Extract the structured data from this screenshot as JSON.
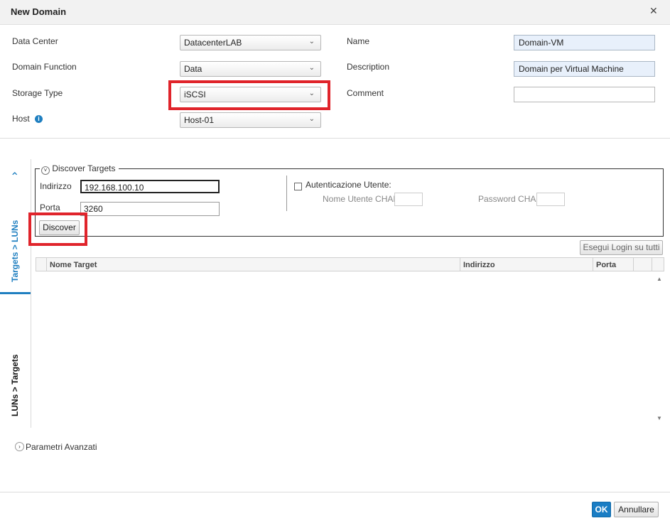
{
  "dialog": {
    "title": "New Domain",
    "close_icon": "✕"
  },
  "form": {
    "data_center": {
      "label": "Data Center",
      "value": "DatacenterLAB"
    },
    "domain_function": {
      "label": "Domain Function",
      "value": "Data"
    },
    "storage_type": {
      "label": "Storage Type",
      "value": "iSCSI"
    },
    "host": {
      "label": "Host",
      "value": "Host-01"
    },
    "name": {
      "label": "Name",
      "value": "Domain-VM"
    },
    "description": {
      "label": "Description",
      "value": "Domain per Virtual Machine"
    },
    "comment": {
      "label": "Comment",
      "value": ""
    }
  },
  "side_tabs": {
    "targets_luns": "Targets > LUNs",
    "luns_targets": "LUNs > Targets"
  },
  "discover": {
    "legend": "Discover Targets",
    "address_label": "Indirizzo",
    "address_value": "192.168.100.10",
    "port_label": "Porta",
    "port_value": "3260",
    "button": "Discover",
    "auth_label": "Autenticazione Utente:",
    "chap_user_label": "Nome Utente CHAP",
    "chap_password_label": "Password CHAP"
  },
  "login_all_button": "Esegui Login su tutti",
  "table": {
    "columns": [
      "Nome Target",
      "Indirizzo",
      "Porta"
    ]
  },
  "advanced": "Parametri Avanzati",
  "footer": {
    "ok": "OK",
    "cancel": "Annullare"
  },
  "colors": {
    "accent": "#1f7fc0",
    "highlight": "#e0242b",
    "ok_button": "#1a7dc4"
  }
}
